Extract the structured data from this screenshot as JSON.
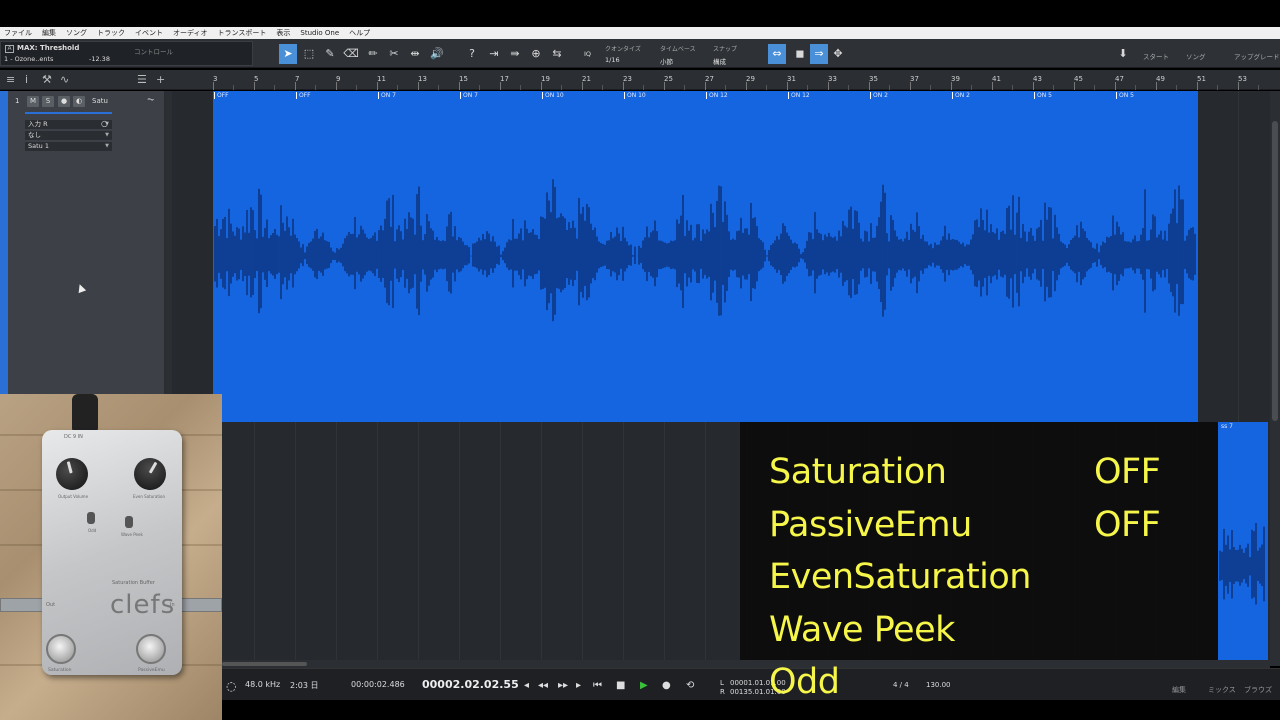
{
  "menu": [
    "ファイル",
    "編集",
    "ソング",
    "トラック",
    "イベント",
    "オーディオ",
    "トランスポート",
    "表示",
    "Studio One",
    "ヘルプ"
  ],
  "control": {
    "title": "MAX: Threshold",
    "device": "1 - Ozone..ents",
    "value": "-12.38",
    "label": "コントロール",
    "a_icon": "A"
  },
  "toolbar": {
    "quantize_label": "クオンタイズ",
    "quantize_value": "1/16",
    "timebase_label": "タイムベース",
    "timebase_value": "小節",
    "snap_label": "スナップ",
    "snap_value": "構成",
    "iq": "IQ",
    "start": "スタート",
    "song": "ソング",
    "upgrade": "アップグレード"
  },
  "track": {
    "number": "1",
    "m": "M",
    "s": "S",
    "name": "Satu",
    "input": "入力 R",
    "output": "なし",
    "insert": "Satu 1"
  },
  "ruler": [
    "3",
    "5",
    "7",
    "9",
    "11",
    "13",
    "15",
    "17",
    "19",
    "21",
    "23",
    "25",
    "27",
    "29",
    "31",
    "33",
    "35",
    "37",
    "39",
    "41",
    "43",
    "45",
    "47",
    "49",
    "51",
    "53"
  ],
  "markers": [
    "OFF",
    "OFF",
    "ON 7",
    "ON 7",
    "ON 10",
    "ON 10",
    "ON 12",
    "ON 12",
    "ON 2",
    "ON 2",
    "ON 5",
    "ON 5"
  ],
  "clip_tail_label": "ss 7",
  "overlay": {
    "row1_label": "Saturation",
    "row1_value": "OFF",
    "row2_label": "PassiveEmu",
    "row2_value": "OFF",
    "row3_label": "EvenSaturation",
    "row4_label": "Wave Peek",
    "row5_label": "Odd"
  },
  "transport": {
    "sample_rate": "48.0 kHz",
    "time_days": "2:03 日",
    "time_sec": "00:00:02.486",
    "position": "00002.02.02.55",
    "l_label": "L",
    "r_label": "R",
    "l_value": "00001.01.01.00",
    "r_value": "00135.01.01.00",
    "signature": "4 / 4",
    "tempo": "130.00",
    "mix": "編集",
    "mixer": "ミックス",
    "browse": "ブラウズ"
  },
  "pedal": {
    "brand": "clefs",
    "subtitle": "Saturation Buffer",
    "knob1": "Output Volume",
    "knob2": "Even Saturation",
    "sw1": "Odd",
    "sw2": "Wave Peek",
    "foot1": "Saturation",
    "foot2": "PassiveEmu",
    "top": "DC 9 IN",
    "side_in": "Out",
    "side_out": "In"
  }
}
